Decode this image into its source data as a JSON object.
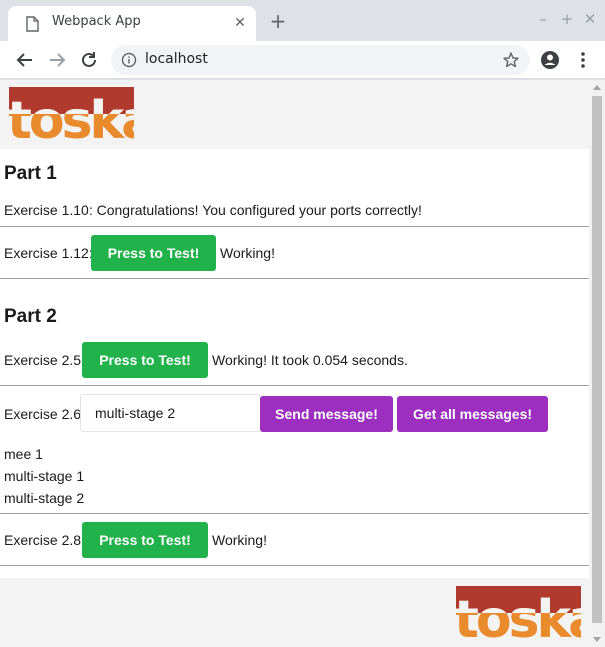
{
  "browser": {
    "tab_title": "Webpack App",
    "close_glyph": "✕",
    "newtab_glyph": "+",
    "minimize_glyph": "–",
    "maximize_glyph": "+",
    "window_close_glyph": "✕",
    "url": "localhost"
  },
  "logo": {
    "text": "toska",
    "colors": {
      "top": "#c0392b",
      "bottom": "#e98a2c"
    }
  },
  "part1": {
    "heading": "Part 1",
    "ex110": {
      "text": "Exercise 1.10: Congratulations! You configured your ports correctly!"
    },
    "ex112": {
      "label": "Exercise 1.12:",
      "button": "Press to Test!",
      "status": "Working!"
    }
  },
  "part2": {
    "heading": "Part 2",
    "ex25": {
      "label": "Exercise 2.5:",
      "button": "Press to Test!",
      "status": "Working! It took 0.054 seconds."
    },
    "ex26": {
      "label": "Exercise 2.6:",
      "input_value": "multi-stage 2",
      "send_button": "Send message!",
      "get_button": "Get all messages!",
      "messages": [
        "mee 1",
        "multi-stage 1",
        "multi-stage 2"
      ]
    },
    "ex28": {
      "label": "Exercise 2.8:",
      "button": "Press to Test!",
      "status": "Working!"
    }
  },
  "colors": {
    "green_button": "#22b24c",
    "purple_button": "#9c2ec0",
    "header_band": "#f3f3f3"
  }
}
